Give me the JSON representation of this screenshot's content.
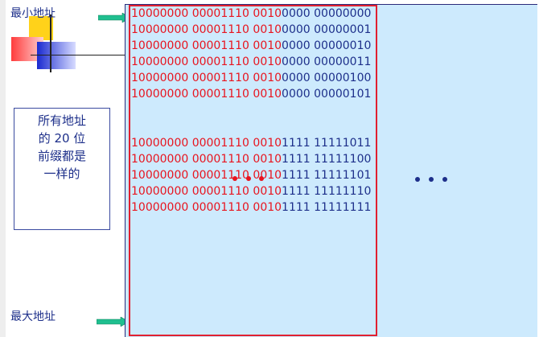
{
  "labels": {
    "min_address": "最小地址",
    "max_address": "最大地址"
  },
  "note": {
    "lines": [
      "所有地址",
      "的 20 位",
      "前缀都是",
      "一样的"
    ]
  },
  "top_addresses": [
    {
      "prefix": "10000000 00001110 0010",
      "suffix": "0000 00000000"
    },
    {
      "prefix": "10000000 00001110 0010",
      "suffix": "0000 00000001"
    },
    {
      "prefix": "10000000 00001110 0010",
      "suffix": "0000 00000010"
    },
    {
      "prefix": "10000000 00001110 0010",
      "suffix": "0000 00000011"
    },
    {
      "prefix": "10000000 00001110 0010",
      "suffix": "0000 00000100"
    },
    {
      "prefix": "10000000 00001110 0010",
      "suffix": "0000 00000101"
    }
  ],
  "bottom_addresses": [
    {
      "prefix": "10000000 00001110 0010",
      "suffix": "1111 11111011"
    },
    {
      "prefix": "10000000 00001110 0010",
      "suffix": "1111 11111100"
    },
    {
      "prefix": "10000000 00001110 0010",
      "suffix": "1111 11111101"
    },
    {
      "prefix": "10000000 00001110 0010",
      "suffix": "1111 11111110"
    },
    {
      "prefix": "10000000 00001110 0010",
      "suffix": "1111 11111111"
    }
  ],
  "colors": {
    "prefix": "#e8141e",
    "suffix": "#1d2f8a",
    "panel": "#cdeafd",
    "arrow": "#1fbf8f"
  }
}
